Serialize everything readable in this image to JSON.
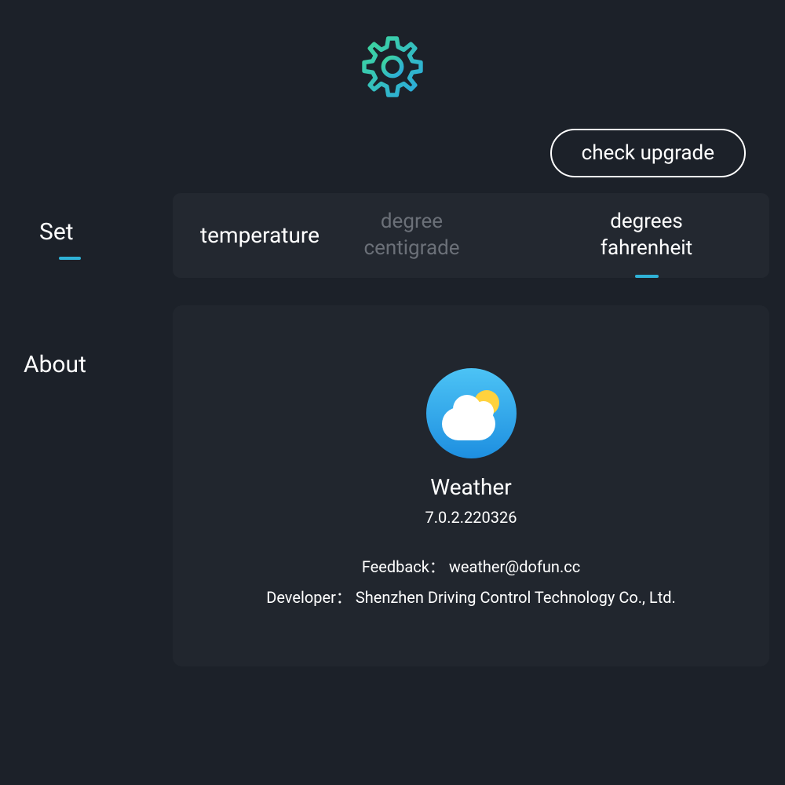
{
  "header": {
    "upgrade_button": "check upgrade"
  },
  "sidebar": {
    "set_label": "Set",
    "about_label": "About"
  },
  "temperature": {
    "label": "temperature",
    "option_centigrade": "degree centigrade",
    "option_fahrenheit": "degrees fahrenheit",
    "selected": "fahrenheit"
  },
  "about": {
    "app_name": "Weather",
    "app_version": "7.0.2.220326",
    "feedback_label": "Feedback：",
    "feedback_value": "weather@dofun.cc",
    "developer_label": "Developer：",
    "developer_value": "Shenzhen Driving Control Technology Co., Ltd."
  }
}
